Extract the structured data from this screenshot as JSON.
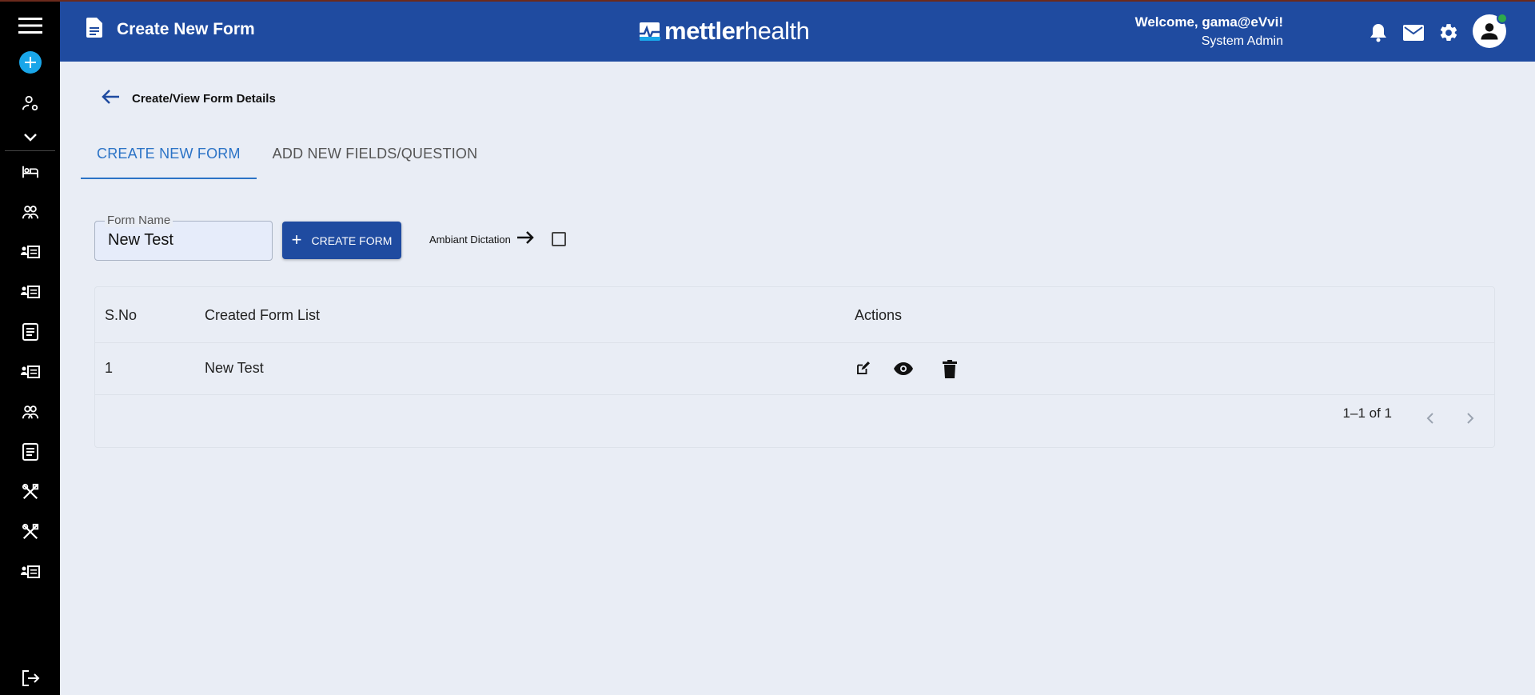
{
  "header": {
    "title": "Create New Form",
    "logo_bold": "mettler",
    "logo_light": "health",
    "welcome": "Welcome, gama@eVvi!",
    "role": "System Admin"
  },
  "page": {
    "breadcrumb": "Create/View Form Details"
  },
  "tabs": [
    {
      "label": "CREATE NEW FORM",
      "active": true
    },
    {
      "label": "ADD NEW FIELDS/QUESTION",
      "active": false
    }
  ],
  "form": {
    "field_label": "Form Name",
    "field_value": "New Test",
    "create_button": "CREATE FORM",
    "ambiant_label": "Ambiant Dictation"
  },
  "table": {
    "headers": {
      "sno": "S.No",
      "list": "Created Form List",
      "actions": "Actions"
    },
    "rows": [
      {
        "sno": "1",
        "name": "New Test"
      }
    ],
    "pagination": "1–1 of 1"
  },
  "colors": {
    "header_bg": "#1f4ba0",
    "sidebar_bg": "#000000",
    "accent_tab": "#2b73c6",
    "add_button": "#19a6e9",
    "online_dot": "#2eaa4a"
  },
  "icons": {
    "sidebar": [
      "menu-icon",
      "add-icon",
      "user-settings-icon",
      "chevron-down-icon",
      "bed-icon",
      "group-icon",
      "id-card-icon",
      "id-card-icon",
      "document-icon",
      "id-card-icon",
      "group-icon",
      "document-icon",
      "tools-icon",
      "tools-icon",
      "id-card-icon",
      "logout-icon"
    ],
    "header": [
      "document-icon",
      "bell-icon",
      "mail-icon",
      "gear-icon",
      "account-icon"
    ],
    "row_actions": [
      "edit-icon",
      "view-icon",
      "delete-icon"
    ]
  }
}
